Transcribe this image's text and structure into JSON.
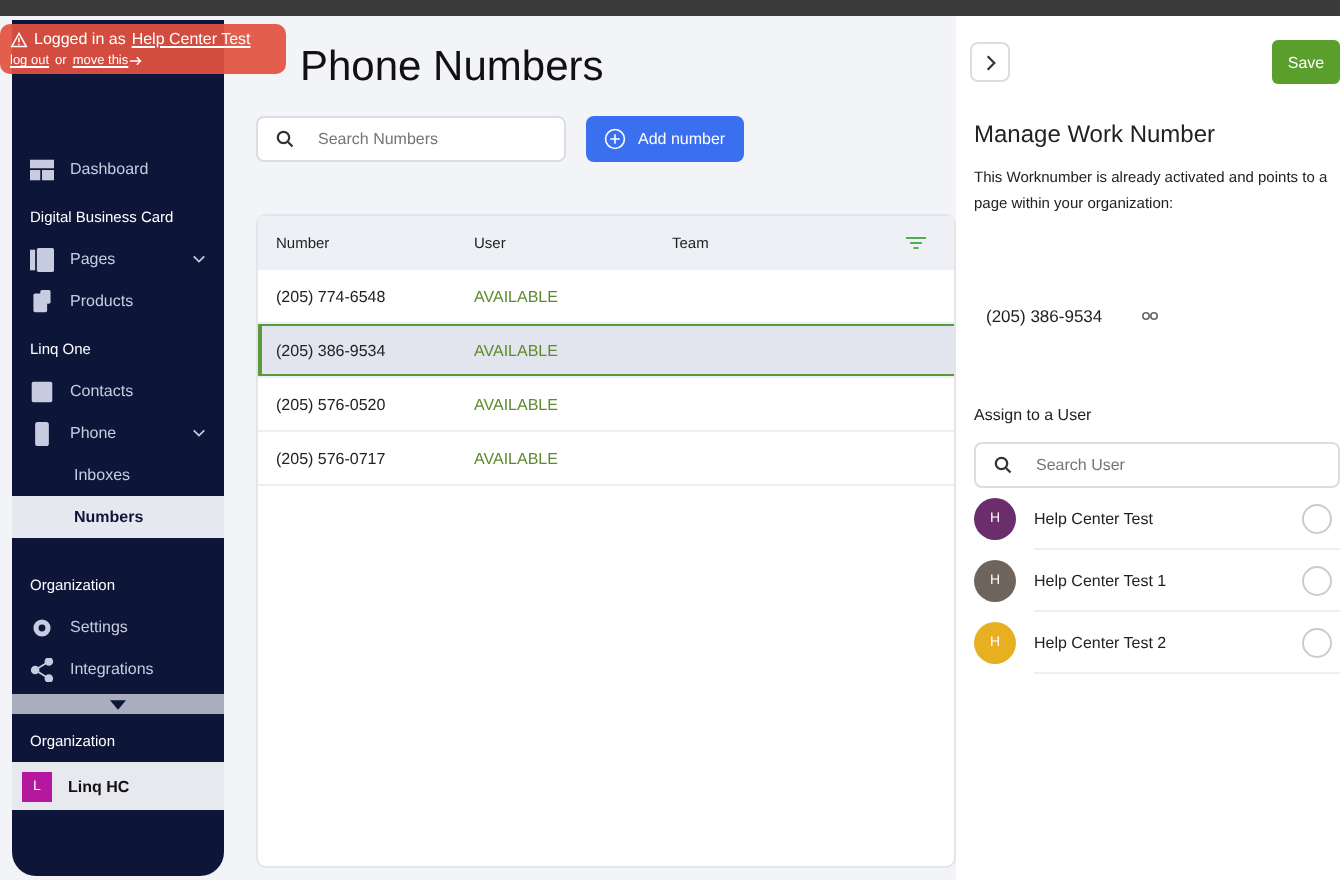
{
  "banner": {
    "prefix": "Logged in as",
    "user": "Help Center Test",
    "logout": "log out",
    "or": "or",
    "move": "move this"
  },
  "sidebar": {
    "items": [
      {
        "kind": "item",
        "label": "Dashboard",
        "expandable": false,
        "selected": false
      },
      {
        "kind": "section",
        "label": "Digital Business Card"
      },
      {
        "kind": "item",
        "label": "Pages",
        "expandable": true,
        "selected": false
      },
      {
        "kind": "item",
        "label": "Products",
        "expandable": false,
        "selected": false
      },
      {
        "kind": "section",
        "label": "Linq One"
      },
      {
        "kind": "item",
        "label": "Contacts",
        "expandable": false,
        "selected": false
      },
      {
        "kind": "item",
        "label": "Phone",
        "expandable": true,
        "selected": false
      },
      {
        "kind": "subitem",
        "label": "Inboxes",
        "selected": false
      },
      {
        "kind": "subitem",
        "label": "Numbers",
        "selected": true
      },
      {
        "kind": "section",
        "label": "Organization"
      },
      {
        "kind": "item",
        "label": "Settings",
        "expandable": false,
        "selected": false
      },
      {
        "kind": "item",
        "label": "Integrations",
        "expandable": false,
        "selected": false
      }
    ],
    "footer_label": "Organization",
    "org": {
      "initial": "L",
      "name": "Linq HC",
      "color": "#b5179e"
    }
  },
  "page": {
    "title": "Phone Numbers",
    "search": {
      "placeholder": "Search Numbers"
    },
    "add_button": "Add number",
    "table": {
      "columns": [
        "Number",
        "User",
        "Team"
      ],
      "rows": [
        {
          "number": "(205) 774-6548",
          "user": "AVAILABLE",
          "selected": false
        },
        {
          "number": "(205) 386-9534",
          "user": "AVAILABLE",
          "selected": true
        },
        {
          "number": "(205) 576-0520",
          "user": "AVAILABLE",
          "selected": false
        },
        {
          "number": "(205) 576-0717",
          "user": "AVAILABLE",
          "selected": false
        }
      ]
    }
  },
  "panel": {
    "save": "Save",
    "title": "Manage Work Number",
    "description": "This Worknumber is already activated and points to a page within your organization:",
    "number": "(205) 386-9534",
    "assign_label": "Assign to a User",
    "search": {
      "placeholder": "Search User"
    },
    "users": [
      {
        "initial": "H",
        "name": "Help Center Test",
        "color": "#6b2d6b",
        "selected": false
      },
      {
        "initial": "H",
        "name": "Help Center Test 1",
        "color": "#6e645c",
        "selected": false
      },
      {
        "initial": "H",
        "name": "Help Center Test 2",
        "color": "#e8b020",
        "selected": false
      }
    ]
  }
}
